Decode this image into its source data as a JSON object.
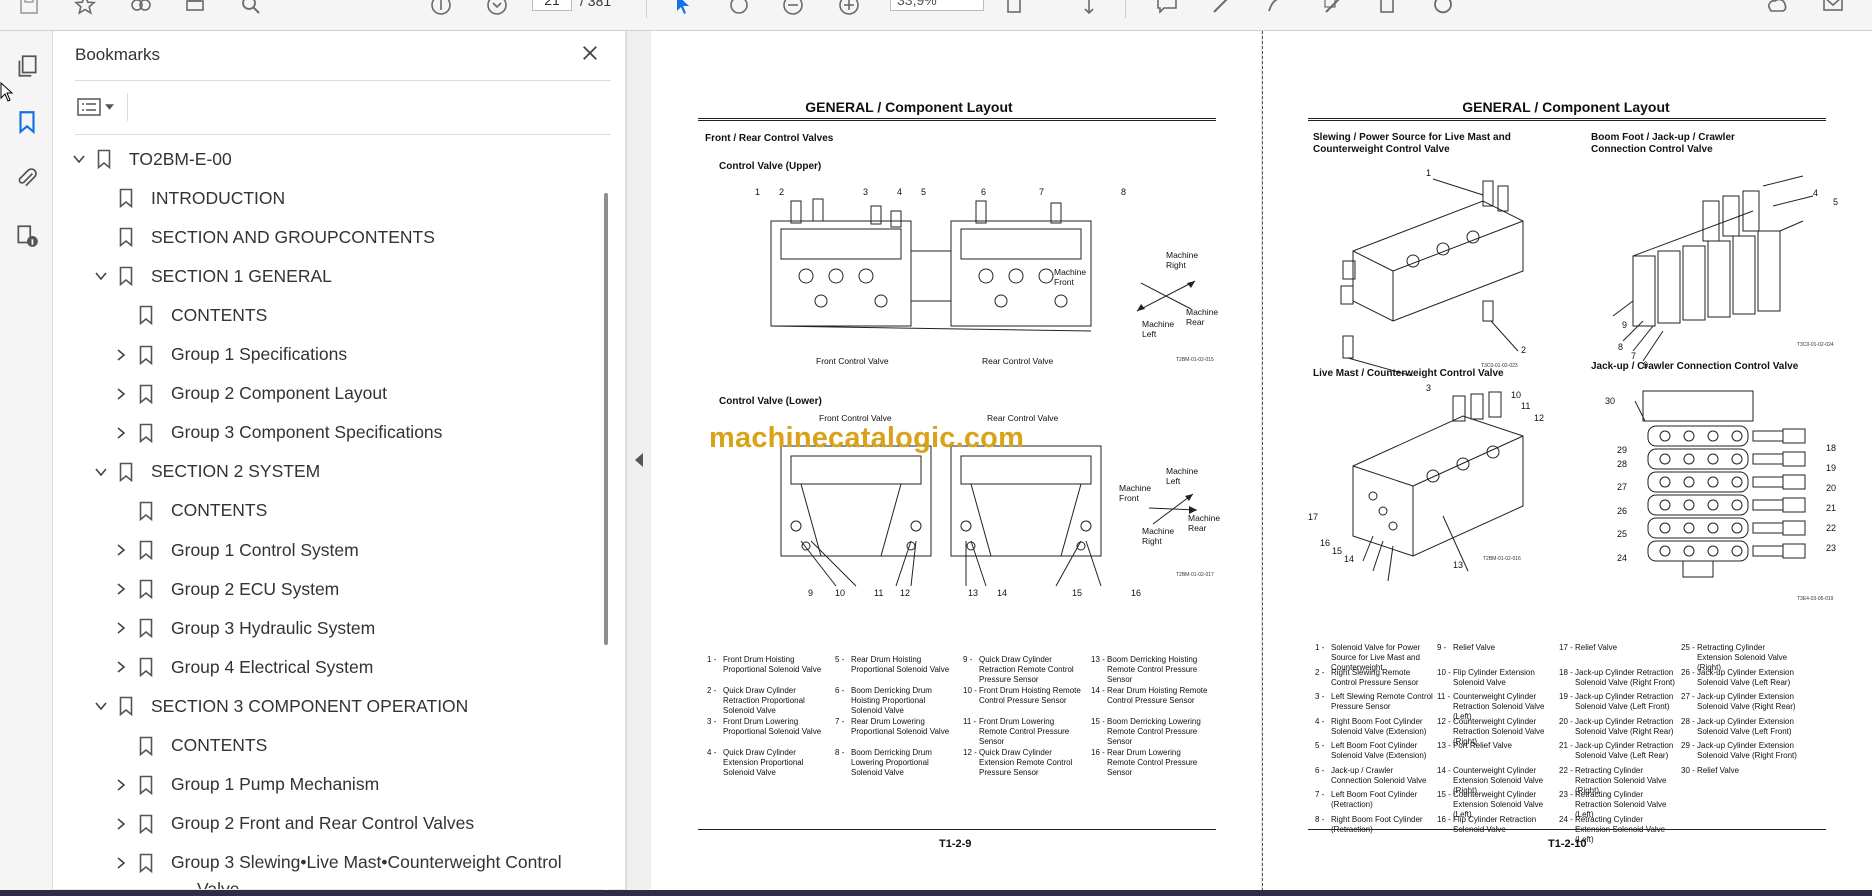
{
  "toolbar": {
    "page_current": "21",
    "page_total": "/ 381",
    "zoom": "33,9%"
  },
  "bookmarks_panel": {
    "title": "Bookmarks",
    "items": [
      {
        "label": "TO2BM-E-00",
        "level": 0,
        "toggle": "expanded"
      },
      {
        "label": "INTRODUCTION",
        "level": 1,
        "toggle": "none"
      },
      {
        "label": "SECTION AND GROUPCONTENTS",
        "level": 1,
        "toggle": "none"
      },
      {
        "label": "SECTION 1 GENERAL",
        "level": 1,
        "toggle": "expanded"
      },
      {
        "label": "CONTENTS",
        "level": 2,
        "toggle": "none"
      },
      {
        "label": "Group 1 Specifications",
        "level": 2,
        "toggle": "collapsed"
      },
      {
        "label": "Group 2 Component Layout",
        "level": 2,
        "toggle": "collapsed"
      },
      {
        "label": "Group 3 Component Specifications",
        "level": 2,
        "toggle": "collapsed"
      },
      {
        "label": "SECTION 2 SYSTEM",
        "level": 1,
        "toggle": "expanded"
      },
      {
        "label": "CONTENTS",
        "level": 2,
        "toggle": "none"
      },
      {
        "label": "Group 1 Control System",
        "level": 2,
        "toggle": "collapsed"
      },
      {
        "label": "Group 2 ECU System",
        "level": 2,
        "toggle": "collapsed"
      },
      {
        "label": "Group 3 Hydraulic System",
        "level": 2,
        "toggle": "collapsed"
      },
      {
        "label": "Group 4 Electrical System",
        "level": 2,
        "toggle": "collapsed"
      },
      {
        "label": "SECTION 3 COMPONENT OPERATION",
        "level": 1,
        "toggle": "expanded"
      },
      {
        "label": "CONTENTS",
        "level": 2,
        "toggle": "none"
      },
      {
        "label": "Group 1 Pump Mechanism",
        "level": 2,
        "toggle": "collapsed"
      },
      {
        "label": "Group 2 Front and Rear Control Valves",
        "level": 2,
        "toggle": "collapsed"
      },
      {
        "label": "Group 3 Slewing•Live Mast•Counterweight Control",
        "level": 2,
        "toggle": "collapsed"
      },
      {
        "label": "Valve",
        "level": 2,
        "toggle": "none",
        "continuation": true
      }
    ]
  },
  "left_page": {
    "header": "GENERAL / Component Layout",
    "section_title": "Front / Rear Control Valves",
    "upper_title": "Control Valve (Upper)",
    "upper_labels": [
      "Front Control Valve",
      "Rear Control Valve"
    ],
    "upper_callouts": [
      "1",
      "2",
      "3",
      "4",
      "5",
      "6",
      "7",
      "8"
    ],
    "upper_directions": [
      "Machine Front",
      "Machine Right",
      "Machine Rear",
      "Machine Left"
    ],
    "upper_code": "T2BM-01-02-015",
    "lower_title": "Control Valve (Lower)",
    "lower_labels": [
      "Front Control Valve",
      "Rear Control Valve"
    ],
    "lower_callouts": [
      "9",
      "10",
      "11",
      "12",
      "13",
      "14",
      "15",
      "16"
    ],
    "lower_directions": [
      "Machine Front",
      "Machine Left",
      "Machine Right",
      "Machine Rear"
    ],
    "lower_code": "T2BM-01-02-017",
    "legend": [
      {
        "n": "1 -",
        "t": "Front Drum Hoisting Proportional Solenoid Valve"
      },
      {
        "n": "2 -",
        "t": "Quick Draw Cylinder Retraction Proportional Solenoid Valve"
      },
      {
        "n": "3 -",
        "t": "Front Drum Lowering Proportional Solenoid Valve"
      },
      {
        "n": "4 -",
        "t": "Quick Draw Cylinder Extension Proportional Solenoid Valve"
      },
      {
        "n": "5 -",
        "t": "Rear Drum Hoisting Proportional Solenoid Valve"
      },
      {
        "n": "6 -",
        "t": "Boom Derricking Drum Hoisting Proportional Solenoid Valve"
      },
      {
        "n": "7 -",
        "t": "Rear Drum Lowering Proportional Solenoid Valve"
      },
      {
        "n": "8 -",
        "t": "Boom Derricking Drum Lowering Proportional Solenoid Valve"
      },
      {
        "n": "9 -",
        "t": "Quick Draw Cylinder Retraction Remote Control Pressure Sensor"
      },
      {
        "n": "10 -",
        "t": "Front Drum Hoisting Remote Control Pressure Sensor"
      },
      {
        "n": "11 -",
        "t": "Front Drum Lowering Remote Control Pressure Sensor"
      },
      {
        "n": "12 -",
        "t": "Quick Draw Cylinder Extension Remote Control Pressure Sensor"
      },
      {
        "n": "13 -",
        "t": "Boom Derricking Hoisting Remote Control Pressure Sensor"
      },
      {
        "n": "14 -",
        "t": "Rear Drum Hoisting Remote Control Pressure Sensor"
      },
      {
        "n": "15 -",
        "t": "Boom Derricking Lowering Remote Control Pressure Sensor"
      },
      {
        "n": "16 -",
        "t": "Rear Drum Lowering Remote Control Pressure Sensor"
      }
    ],
    "footer": "T1-2-9",
    "watermark": "machinecatalogic.com"
  },
  "right_page": {
    "header": "GENERAL / Component Layout",
    "fig1_title": "Slewing / Power Source for Live Mast and Counterweight Control Valve",
    "fig1_callouts": [
      "1",
      "2",
      "3"
    ],
    "fig1_code": "T3C0-01-02-023",
    "fig2_title": "Boom Foot / Jack-up / Crawler Connection Control Valve",
    "fig2_callouts": [
      "4",
      "5",
      "6",
      "7",
      "8",
      "9"
    ],
    "fig2_code": "T3C0-01-02-024",
    "fig3_title": "Live Mast / Counterweight Control Valve",
    "fig3_callouts": [
      "10",
      "11",
      "12",
      "13",
      "14",
      "15",
      "16",
      "17"
    ],
    "fig3_code": "T2BM-01-02-016",
    "fig4_title": "Jack-up / Crawler Connection Control Valve",
    "fig4_callouts": [
      "18",
      "19",
      "20",
      "21",
      "22",
      "23",
      "24",
      "25",
      "26",
      "27",
      "28",
      "29",
      "30"
    ],
    "fig4_code": "T3E4-03-05-019",
    "legend": [
      {
        "n": "1 -",
        "t": "Solenoid Valve for Power Source for Live Mast and Counterweight"
      },
      {
        "n": "2 -",
        "t": "Right Slewing Remote Control Pressure Sensor"
      },
      {
        "n": "3 -",
        "t": "Left Slewing Remote Control Pressure Sensor"
      },
      {
        "n": "4 -",
        "t": "Right Boom Foot Cylinder Solenoid Valve (Extension)"
      },
      {
        "n": "5 -",
        "t": "Left Boom Foot Cylinder Solenoid Valve (Extension)"
      },
      {
        "n": "6 -",
        "t": "Jack-up / Crawler Connection Solenoid Valve"
      },
      {
        "n": "7 -",
        "t": "Left Boom Foot Cylinder (Retraction)"
      },
      {
        "n": "8 -",
        "t": "Right Boom Foot Cylinder (Retraction)"
      },
      {
        "n": "9 -",
        "t": "Relief Valve"
      },
      {
        "n": "10 -",
        "t": "Flip Cylinder Extension Solenoid Valve"
      },
      {
        "n": "11 -",
        "t": "Counterweight Cylinder Retraction Solenoid Valve (Left)"
      },
      {
        "n": "12 -",
        "t": "Counterweight Cylinder Retraction Solenoid Valve (Right)"
      },
      {
        "n": "13 -",
        "t": "Port Relief Valve"
      },
      {
        "n": "14 -",
        "t": "Counterweight Cylinder Extension Solenoid Valve (Right)"
      },
      {
        "n": "15 -",
        "t": "Counterweight Cylinder Extension Solenoid Valve (Left)"
      },
      {
        "n": "16 -",
        "t": "Flip Cylinder Retraction Solenoid Valve"
      },
      {
        "n": "17 -",
        "t": "Relief Valve"
      },
      {
        "n": "18 -",
        "t": "Jack-up Cylinder Retraction Solenoid Valve (Right Front)"
      },
      {
        "n": "19 -",
        "t": "Jack-up Cylinder Retraction Solenoid Valve (Left Front)"
      },
      {
        "n": "20 -",
        "t": "Jack-up Cylinder Retraction Solenoid Valve (Right Rear)"
      },
      {
        "n": "21 -",
        "t": "Jack-up Cylinder Retraction Solenoid Valve (Left Rear)"
      },
      {
        "n": "22 -",
        "t": "Retracting Cylinder Retraction Solenoid Valve (Right)"
      },
      {
        "n": "23 -",
        "t": "Retracting Cylinder Retraction Solenoid Valve (Left)"
      },
      {
        "n": "24 -",
        "t": "Retracting Cylinder Extension Solenoid Valve (Left)"
      },
      {
        "n": "25 -",
        "t": "Retracting Cylinder Extension Solenoid Valve (Right)"
      },
      {
        "n": "26 -",
        "t": "Jack-up Cylinder Extension Solenoid Valve (Left Rear)"
      },
      {
        "n": "27 -",
        "t": "Jack-up Cylinder Extension Solenoid Valve (Right Rear)"
      },
      {
        "n": "28 -",
        "t": "Jack-up Cylinder Extension Solenoid Valve (Left Front)"
      },
      {
        "n": "29 -",
        "t": "Jack-up Cylinder Extension Solenoid Valve (Right Front)"
      },
      {
        "n": "30 -",
        "t": "Relief Valve"
      }
    ],
    "footer": "T1-2-10"
  }
}
